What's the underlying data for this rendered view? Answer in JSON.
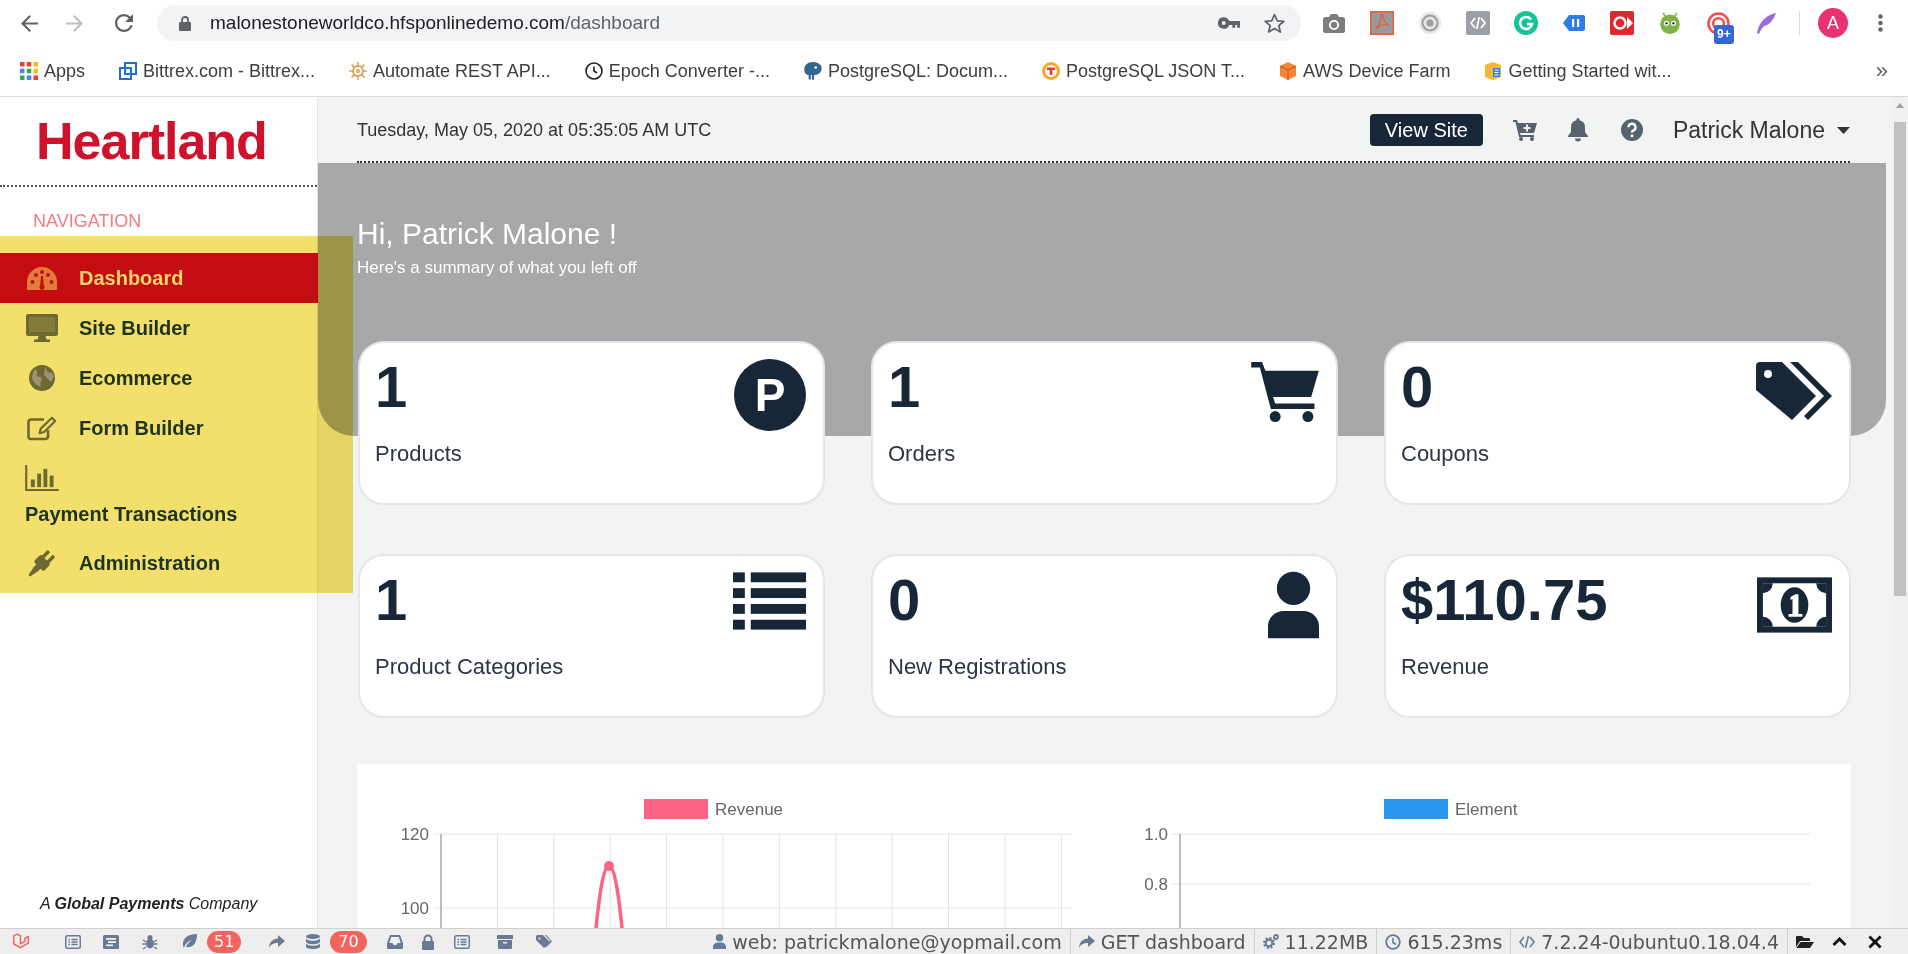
{
  "browser": {
    "url_host": "malonestoneworldco.hfsponlinedemo.com",
    "url_path": "/dashboard",
    "extension_badge": "9+",
    "profile_initial": "A",
    "bookmarks": [
      {
        "label": "Apps"
      },
      {
        "label": "Bittrex.com - Bittrex..."
      },
      {
        "label": "Automate REST API..."
      },
      {
        "label": "Epoch Converter -..."
      },
      {
        "label": "PostgreSQL: Docum..."
      },
      {
        "label": "PostgreSQL JSON T..."
      },
      {
        "label": "AWS Device Farm"
      },
      {
        "label": "Getting Started wit..."
      }
    ],
    "more_bookmarks": "»"
  },
  "sidebar": {
    "logo": "Heartland",
    "section_label": "NAVIGATION",
    "highlighted": true,
    "items": [
      {
        "label": "Dashboard",
        "selected": true
      },
      {
        "label": "Site Builder",
        "selected": false
      },
      {
        "label": "Ecommerce",
        "selected": false
      },
      {
        "label": "Form Builder",
        "selected": false
      },
      {
        "label": "Payment Transactions",
        "selected": false
      },
      {
        "label": "Administration",
        "selected": false
      }
    ],
    "footer": "A **Global Payments** Company"
  },
  "header": {
    "datetime": "Tuesday, May 05, 2020 at 05:35:05 AM UTC",
    "view_site_button": "View Site",
    "user_name": "Patrick Malone"
  },
  "hero": {
    "greeting": "Hi, Patrick Malone !",
    "summary": "Here's a summary of what you left off"
  },
  "stat_cards": [
    {
      "value": "1",
      "label": "Products",
      "icon_letter": "P"
    },
    {
      "value": "1",
      "label": "Orders"
    },
    {
      "value": "0",
      "label": "Coupons"
    },
    {
      "value": "1",
      "label": "Product Categories"
    },
    {
      "value": "0",
      "label": "New Registrations"
    },
    {
      "value": "$110.75",
      "label": "Revenue"
    }
  ],
  "charts": [
    {
      "legend": "Revenue",
      "y_tick_labels": [
        "120",
        "100"
      ]
    },
    {
      "legend": "Element",
      "y_tick_labels": [
        "1.0",
        "0.8"
      ]
    }
  ],
  "debug_bar": {
    "views_count": "51",
    "queries_count": "70",
    "user": "web: patrickmalone@yopmail.com",
    "route": "GET dashboard",
    "memory": "11.22MB",
    "duration": "615.23ms",
    "php_version": "7.2.24-0ubuntu0.18.04.4"
  }
}
